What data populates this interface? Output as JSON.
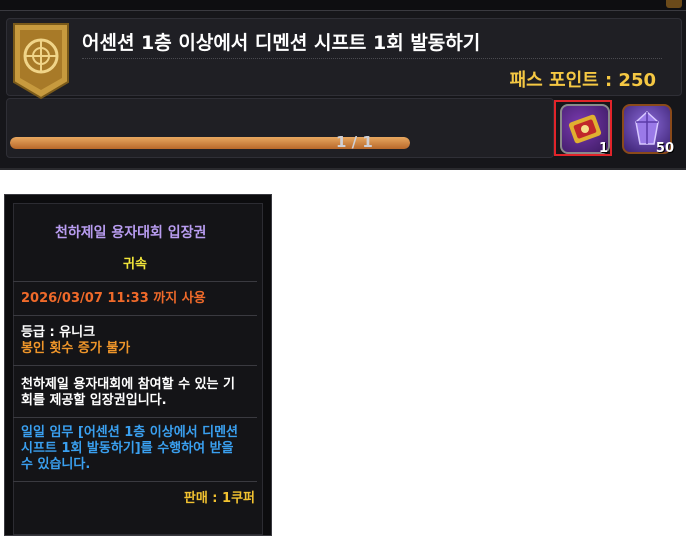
{
  "quest": {
    "title": "어센션 1층 이상에서 디멘션 시프트 1회 발동하기",
    "points": "패스 포인트 : 250",
    "progress_text": "1 / 1",
    "progress_fraction": 1.0,
    "rewards": [
      {
        "icon": "ticket-icon",
        "quantity": "1"
      },
      {
        "icon": "crystal-icon",
        "quantity": "50"
      }
    ]
  },
  "tooltip": {
    "name": "천하제일 용자대회 입장권",
    "bound": "귀속",
    "expiry": "2026/03/07 11:33 까지 사용",
    "grade": "등급 : 유니크",
    "seal": "봉인 횟수 증가 불가",
    "desc_line1": "천하제일 용자대회에 참여할 수 있는 기",
    "desc_line2": "회를 제공할 입장권입니다.",
    "source_line1": "일일 임무 [어센션 1층 이상에서 디멘션",
    "source_line2": "시프트 1회 발동하기]를 수행하여 받을",
    "source_line3": "수 있습니다.",
    "sell": "판매 : 1쿠퍼"
  },
  "colors": {
    "title_purple": "#b89cf0",
    "bound_yellow": "#f2e63a",
    "expiry_orange": "#f06a2a",
    "seal_orange": "#f0962a",
    "source_blue": "#3aa0f0",
    "sell_yellow": "#f2c230",
    "points_gold": "#f5c843"
  }
}
